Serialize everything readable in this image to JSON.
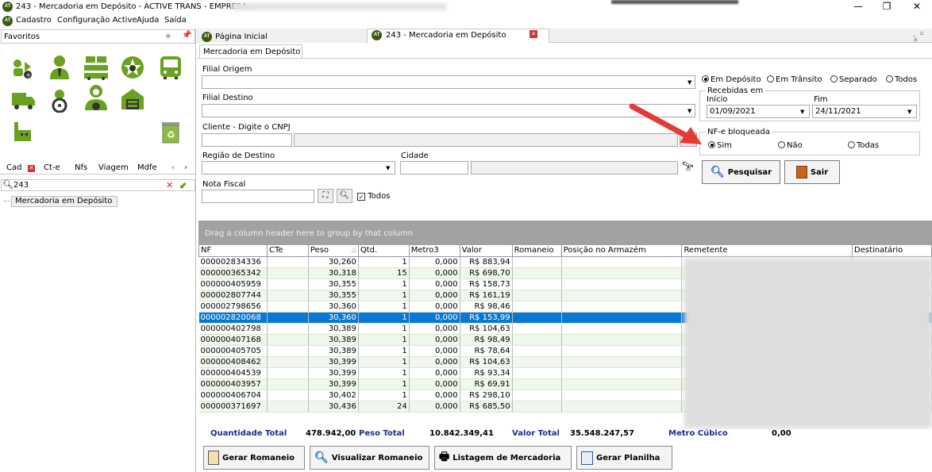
{
  "window": {
    "title": "243 - Mercadoria em Depósito - ACTIVE TRANS - EMPRESA:",
    "logo_text": "AT"
  },
  "menu": [
    "Cadastro",
    "Configuração Active",
    "Ajuda",
    "Saída"
  ],
  "left_panel": {
    "favorites_label": "Favoritos",
    "tabs": [
      "Cad",
      "Ct-e",
      "Nfs",
      "Viagem",
      "Mdfe"
    ],
    "search_value": "243",
    "tree_item": "Mercadoria em Depósito"
  },
  "doc_tabs": [
    "Página Inicial",
    "243 - Mercadoria em Depósito"
  ],
  "subtab": "Mercadoria em Depósito",
  "form": {
    "filial_origem_label": "Filial Origem",
    "filial_destino_label": "Filial Destino",
    "cliente_label": "Cliente - Digite o CNPJ",
    "regiao_label": "Região de Destino",
    "cidade_label": "Cidade",
    "nota_fiscal_label": "Nota Fiscal",
    "todos_label": "Todos",
    "status_options": [
      "Em Depósito",
      "Em Trânsito",
      "Separado",
      "Todos"
    ],
    "recebidas_label": "Recebidas em",
    "inicio_label": "Início",
    "inicio_value": "01/09/2021",
    "fim_label": "Fim",
    "fim_value": "24/11/2021",
    "nfe_label": "NF-e bloqueada",
    "nfe_options": [
      "Sim",
      "Não",
      "Todas"
    ],
    "pesquisar": "Pesquisar",
    "sair": "Sair"
  },
  "grid": {
    "group_hint": "Drag a column header here to group by that column",
    "columns": [
      "NF",
      "CTe",
      "Peso",
      "Qtd.",
      "Metro3",
      "Valor",
      "Romaneio",
      "Posição no Armazém",
      "Remetente",
      "Destinatário"
    ],
    "selected_index": 5,
    "rows": [
      [
        "000002834336",
        "",
        "30,260",
        "1",
        "0,000",
        "R$ 883,94"
      ],
      [
        "000000365342",
        "",
        "30,318",
        "15",
        "0,000",
        "R$ 698,70"
      ],
      [
        "000000405959",
        "",
        "30,355",
        "1",
        "0,000",
        "R$ 158,73"
      ],
      [
        "000002807744",
        "",
        "30,355",
        "1",
        "0,000",
        "R$ 161,19"
      ],
      [
        "000002798656",
        "",
        "30,360",
        "1",
        "0,000",
        "R$ 98,46"
      ],
      [
        "000002820068",
        "",
        "30,360",
        "1",
        "0,000",
        "R$ 153,99"
      ],
      [
        "000000402798",
        "",
        "30,389",
        "1",
        "0,000",
        "R$ 104,63"
      ],
      [
        "000000407168",
        "",
        "30,389",
        "1",
        "0,000",
        "R$ 98,49"
      ],
      [
        "000000405705",
        "",
        "30,389",
        "1",
        "0,000",
        "R$ 78,64"
      ],
      [
        "000000408462",
        "",
        "30,399",
        "1",
        "0,000",
        "R$ 104,63"
      ],
      [
        "000000404539",
        "",
        "30,399",
        "1",
        "0,000",
        "R$ 93,34"
      ],
      [
        "000000403957",
        "",
        "30,399",
        "1",
        "0,000",
        "R$ 69,91"
      ],
      [
        "000000406704",
        "",
        "30,402",
        "1",
        "0,000",
        "R$ 298,10"
      ],
      [
        "000000371697",
        "",
        "30,436",
        "24",
        "0,000",
        "R$ 685,50"
      ]
    ]
  },
  "totals": {
    "quantidade_label": "Quantidade Total",
    "quantidade_value": "478.942,00",
    "peso_label": "Peso Total",
    "peso_value": "10.842.349,41",
    "valor_label": "Valor Total",
    "valor_value": "35.548.247,57",
    "metro_label": "Metro Cúbico",
    "metro_value": "0,00"
  },
  "bottom_buttons": [
    "Gerar Romaneio",
    "Visualizar Romaneio",
    "Listagem de Mercadoria",
    "Gerar Planilha"
  ],
  "colors": {
    "accent_green": "#6aa121",
    "selection_blue": "#0a77d5",
    "totals_blue": "#1c2d8c",
    "arrow_red": "#e53935"
  }
}
